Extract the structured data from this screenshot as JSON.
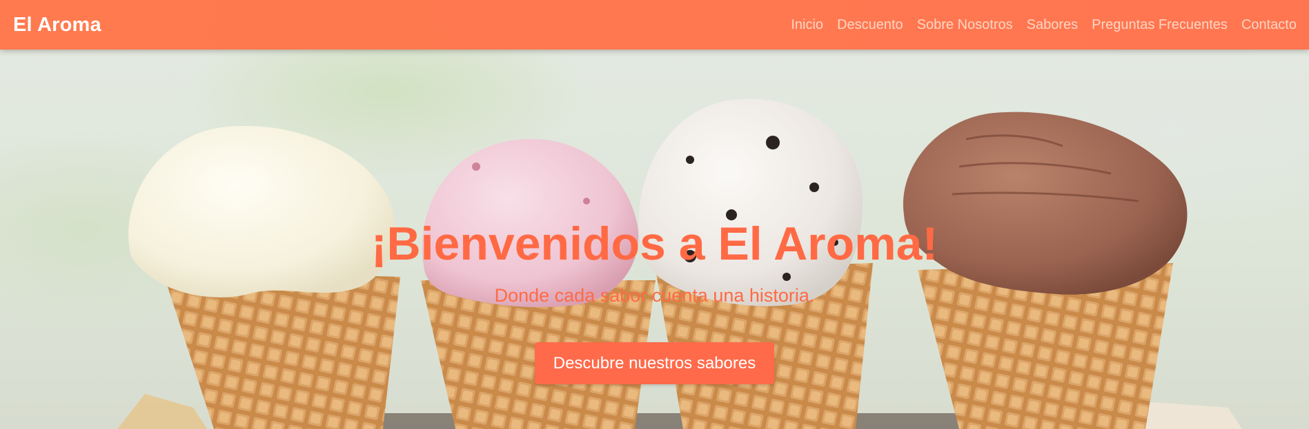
{
  "navbar": {
    "brand": "El Aroma",
    "links": [
      {
        "label": "Inicio"
      },
      {
        "label": "Descuento"
      },
      {
        "label": "Sobre Nosotros"
      },
      {
        "label": "Sabores"
      },
      {
        "label": "Preguntas Frecuentes"
      },
      {
        "label": "Contacto"
      }
    ]
  },
  "hero": {
    "title": "¡Bienvenidos a El Aroma!",
    "subtitle": "Donde cada sabor cuenta una historia.",
    "cta_label": "Descubre nuestros sabores"
  },
  "colors": {
    "navbar": "#ff7a4f",
    "accent": "#ff6a45",
    "button": "#ff6a4a",
    "nav_link": "#ffd6c4"
  }
}
